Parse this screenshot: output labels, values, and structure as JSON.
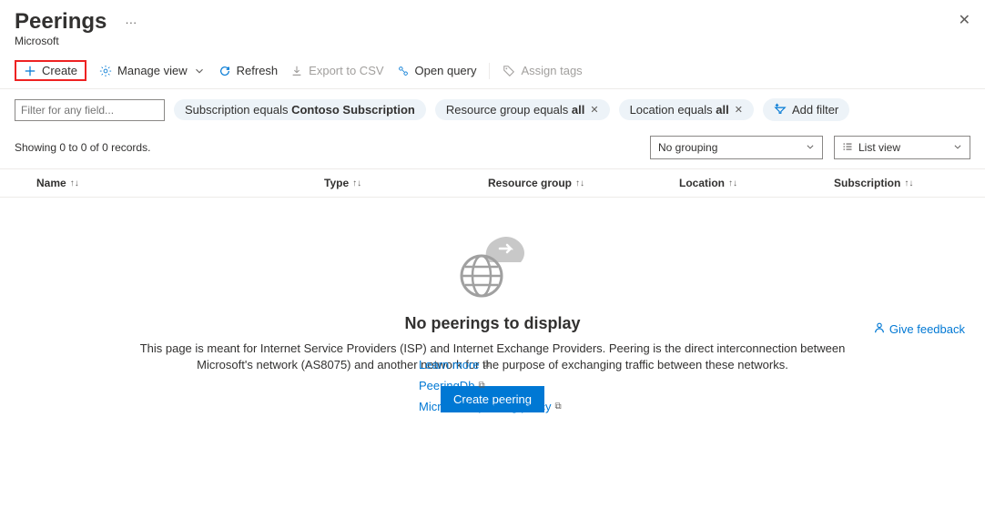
{
  "header": {
    "title": "Peerings",
    "subtitle": "Microsoft"
  },
  "toolbar": {
    "create": "Create",
    "manage_view": "Manage view",
    "refresh": "Refresh",
    "export_csv": "Export to CSV",
    "open_query": "Open query",
    "assign_tags": "Assign tags"
  },
  "filters": {
    "input_placeholder": "Filter for any field...",
    "subscription": {
      "prefix": "Subscription equals ",
      "value": "Contoso Subscription"
    },
    "resource_group": {
      "prefix": "Resource group equals ",
      "value": "all"
    },
    "location": {
      "prefix": "Location equals ",
      "value": "all"
    },
    "add_filter": "Add filter"
  },
  "status": {
    "records": "Showing 0 to 0 of 0 records.",
    "grouping": "No grouping",
    "view": "List view"
  },
  "columns": {
    "name": "Name",
    "type": "Type",
    "resource_group": "Resource group",
    "location": "Location",
    "subscription": "Subscription"
  },
  "empty": {
    "title": "No peerings to display",
    "description": "This page is meant for Internet Service Providers (ISP) and Internet Exchange Providers. Peering is the direct interconnection between Microsoft's network (AS8075) and another network for the purpose of exchanging traffic between these networks.",
    "button": "Create peering",
    "links": {
      "learn_more": "Learn more",
      "peeringdb": "PeeringDb",
      "policy": "Microsoft's peering policy"
    },
    "feedback": "Give feedback"
  }
}
